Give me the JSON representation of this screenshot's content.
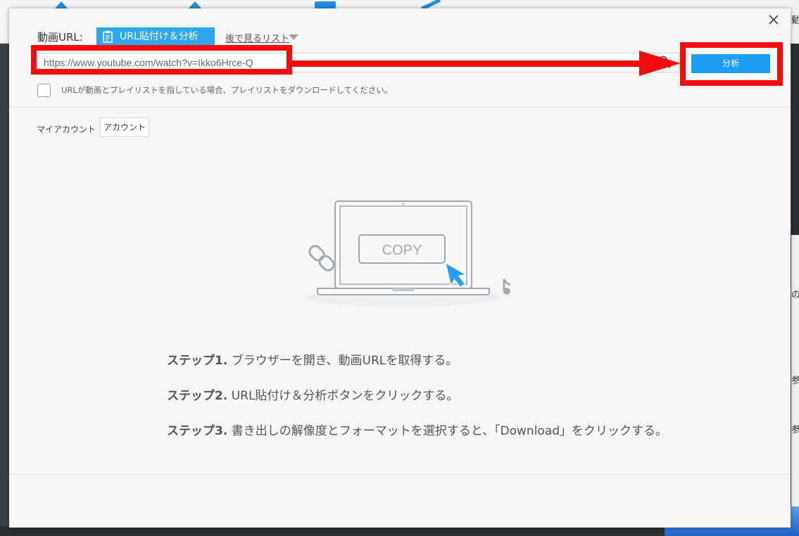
{
  "dialog": {
    "url_label": "動画URL:",
    "paste_button": "URL貼付け＆分析",
    "later_list_link": "後で見るリスト",
    "url_value": "https://www.youtube.com/watch?v=Ikko6Hrce-Q",
    "analyze_button": "分析",
    "playlist_option": "URLが動画とプレイリストを指している場合、プレイリストをダウンロードしてください。",
    "my_account_label": "マイアカウント",
    "account_button": "アカウント",
    "illustration_button": "COPY",
    "steps": [
      {
        "label": "ステップ1.",
        "text": "ブラウザーを開き、動画URLを取得する。"
      },
      {
        "label": "ステップ2.",
        "text": "URL貼付け＆分析ボタンをクリックする。"
      },
      {
        "label": "ステップ3.",
        "text": "書き出しの解像度とフォーマットを選択すると、「Download」をクリックする。"
      }
    ]
  },
  "background_app": {
    "right_fragments": [
      "動",
      "の",
      "参",
      "参"
    ]
  },
  "colors": {
    "accent": "#1e9ef2",
    "annotation": "#f20d0d",
    "dialog_bg": "#f6f6f6"
  },
  "icons": {
    "close": "close-icon",
    "clipboard": "clipboard-icon",
    "dropdown": "chevron-down-icon",
    "search": "search-icon",
    "link": "link-icon",
    "cursor": "cursor-icon",
    "music": "music-note-icon"
  }
}
